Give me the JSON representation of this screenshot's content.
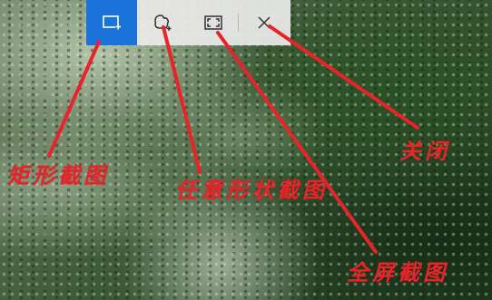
{
  "toolbar": {
    "tools": [
      {
        "name": "rect-snip",
        "icon": "rectangle-snip-icon",
        "active": true
      },
      {
        "name": "freeform-snip",
        "icon": "freeform-snip-icon",
        "active": false
      },
      {
        "name": "fullscreen-snip",
        "icon": "fullscreen-snip-icon",
        "active": false
      },
      {
        "name": "close",
        "icon": "close-icon",
        "active": false
      }
    ],
    "accent_color": "#1a73d9"
  },
  "annotations": {
    "rect_label": "矩形截图",
    "freeform_label": "任意形状截图",
    "close_label": "关闭",
    "fullscreen_label": "全屏截图",
    "color": "#e8232a"
  }
}
